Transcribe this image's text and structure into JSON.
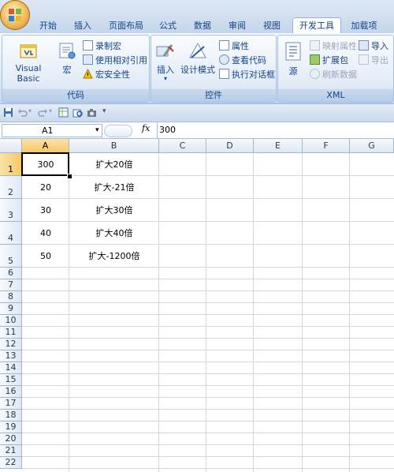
{
  "tabs": [
    "开始",
    "插入",
    "页面布局",
    "公式",
    "数据",
    "审阅",
    "视图",
    "开发工具",
    "加载项"
  ],
  "active_tab": "开发工具",
  "ribbon": {
    "code_group": {
      "label": "代码",
      "visual_basic": "Visual Basic",
      "macros": "宏",
      "record_macro": "录制宏",
      "relative_refs": "使用相对引用",
      "macro_security": "宏安全性"
    },
    "controls_group": {
      "label": "控件",
      "insert": "插入",
      "design_mode": "设计模式",
      "properties": "属性",
      "view_code": "查看代码",
      "run_dialog": "执行对话框"
    },
    "xml_group": {
      "label": "XML",
      "source": "源",
      "map_properties": "映射属性",
      "expansion_packs": "扩展包",
      "refresh_data": "刷新数据",
      "import": "导入",
      "export": "导出"
    }
  },
  "formula_bar": {
    "name_box": "A1",
    "fx": "fx",
    "value": "300"
  },
  "columns": [
    "A",
    "B",
    "C",
    "D",
    "E",
    "F",
    "G"
  ],
  "rows": [
    "1",
    "2",
    "3",
    "4",
    "5",
    "6",
    "7",
    "8",
    "9",
    "10",
    "11",
    "12",
    "13",
    "14",
    "15",
    "16",
    "17",
    "18",
    "19",
    "20",
    "21",
    "22"
  ],
  "cells": {
    "A": [
      "300",
      "20",
      "30",
      "40",
      "50"
    ],
    "B": [
      "扩大20倍",
      "扩大-21倍",
      "扩大30倍",
      "扩大40倍",
      "扩大-1200倍"
    ]
  },
  "selected_cell": "A1",
  "colors": {
    "accent": "#15428b",
    "ribbon": "#dbe6f4",
    "selection": "#f6c867"
  }
}
